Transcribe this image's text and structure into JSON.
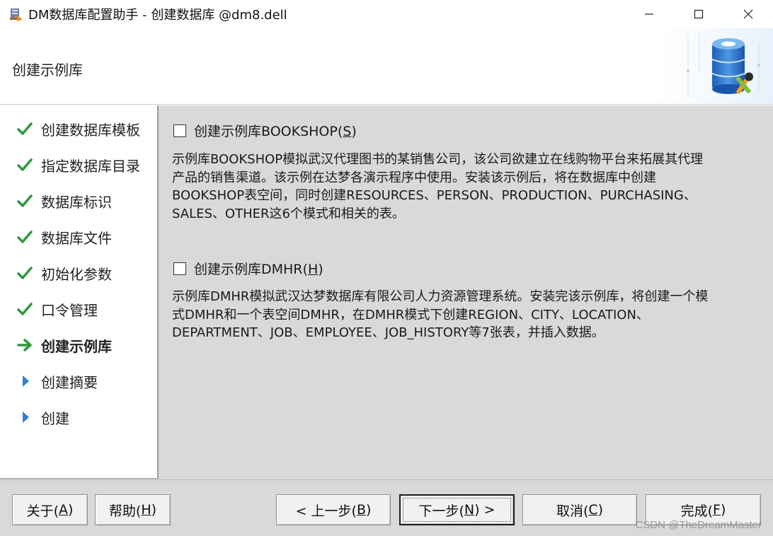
{
  "window": {
    "title": "DM数据库配置助手 - 创建数据库 @dm8.dell",
    "controls": [
      "minimize",
      "maximize",
      "close"
    ]
  },
  "header": {
    "title": "创建示例库",
    "art_icon": "database-gear-icon"
  },
  "steps": [
    {
      "label": "创建数据库模板",
      "status": "done"
    },
    {
      "label": "指定数据库目录",
      "status": "done"
    },
    {
      "label": "数据库标识",
      "status": "done"
    },
    {
      "label": "数据库文件",
      "status": "done"
    },
    {
      "label": "初始化参数",
      "status": "done"
    },
    {
      "label": "口令管理",
      "status": "done"
    },
    {
      "label": "创建示例库",
      "status": "current"
    },
    {
      "label": "创建摘要",
      "status": "pending"
    },
    {
      "label": "创建",
      "status": "pending"
    }
  ],
  "options": {
    "bookshop": {
      "label": "创建示例库BOOKSHOP(",
      "mnemonic": "S",
      "label_end": ")",
      "checked": false,
      "description": [
        "示例库BOOKSHOP模拟武汉代理图书的某销售公司，该公司欲建立在线购物平台来拓展其代理",
        "产品的销售渠道。该示例在达梦各演示程序中使用。安装该示例后，将在数据库中创建",
        "BOOKSHOP表空间，同时创建RESOURCES、PERSON、PRODUCTION、PURCHASING、",
        "SALES、OTHER这6个模式和相关的表。"
      ]
    },
    "dmhr": {
      "label": "创建示例库DMHR(",
      "mnemonic": "H",
      "label_end": ")",
      "checked": false,
      "description": [
        "示例库DMHR模拟武汉达梦数据库有限公司人力资源管理系统。安装完该示例库，将创建一个模",
        "式DMHR和一个表空间DMHR，在DMHR模式下创建REGION、CITY、LOCATION、",
        "DEPARTMENT、JOB、EMPLOYEE、JOB_HISTORY等7张表，并插入数据。"
      ]
    }
  },
  "buttons": {
    "about": {
      "pre": "关于(",
      "key": "A",
      "post": ")"
    },
    "help": {
      "pre": "帮助(",
      "key": "H",
      "post": ")"
    },
    "prev": {
      "pre": "< 上一步(",
      "key": "B",
      "post": ")"
    },
    "next": {
      "pre": "下一步(",
      "key": "N",
      "post": ") >"
    },
    "cancel": {
      "pre": "取消(",
      "key": "C",
      "post": ")"
    },
    "finish": {
      "pre": "完成(",
      "key": "F",
      "post": ")"
    }
  },
  "watermark": "CSDN @TheDreamMaster",
  "colors": {
    "done_check": "#2e9a3a",
    "current_arrow": "#2e9a3a",
    "pending_triangle": "#2f7fd6",
    "panel_bg": "#d9d9d9"
  }
}
